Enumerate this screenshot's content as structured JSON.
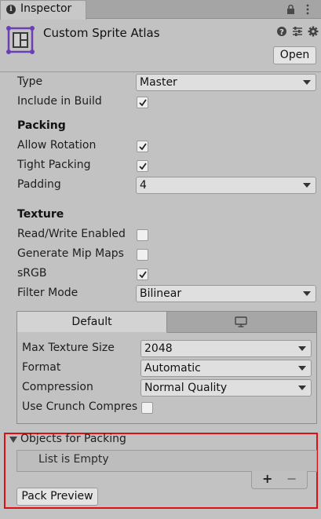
{
  "tab": {
    "title": "Inspector",
    "info_glyph": "i"
  },
  "header": {
    "title": "Custom Sprite Atlas",
    "open_label": "Open"
  },
  "properties": {
    "type": {
      "label": "Type",
      "value": "Master"
    },
    "include_in_build": {
      "label": "Include in Build",
      "checked": true
    }
  },
  "packing": {
    "heading": "Packing",
    "allow_rotation": {
      "label": "Allow Rotation",
      "checked": true
    },
    "tight_packing": {
      "label": "Tight Packing",
      "checked": true
    },
    "padding": {
      "label": "Padding",
      "value": "4"
    }
  },
  "texture": {
    "heading": "Texture",
    "read_write": {
      "label": "Read/Write Enabled",
      "checked": false
    },
    "mip_maps": {
      "label": "Generate Mip Maps",
      "checked": false
    },
    "srgb": {
      "label": "sRGB",
      "checked": true
    },
    "filter_mode": {
      "label": "Filter Mode",
      "value": "Bilinear"
    }
  },
  "platform": {
    "tab_default": "Default",
    "max_texture_size": {
      "label": "Max Texture Size",
      "value": "2048"
    },
    "format": {
      "label": "Format",
      "value": "Automatic"
    },
    "compression": {
      "label": "Compression",
      "value": "Normal Quality"
    },
    "crunch": {
      "label": "Use Crunch Compres",
      "checked": false
    }
  },
  "objects": {
    "heading": "Objects for Packing",
    "empty_text": "List is Empty",
    "add_glyph": "+",
    "remove_glyph": "−"
  },
  "pack_preview_label": "Pack Preview",
  "colors": {
    "highlight_border": "#e01010",
    "asset_icon": "#6a3fb5"
  }
}
